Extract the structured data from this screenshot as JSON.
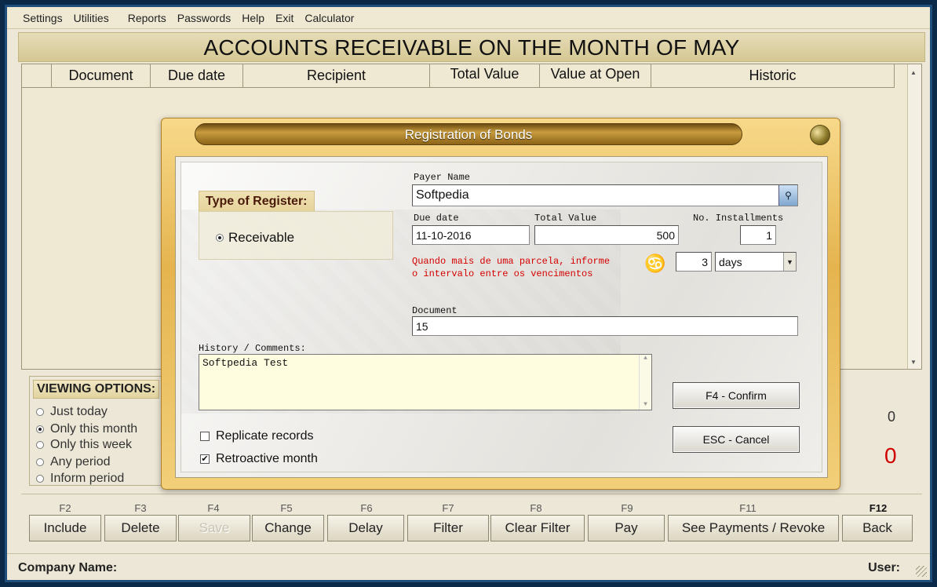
{
  "menu": [
    "Settings",
    "Utilities",
    "Reports",
    "Passwords",
    "Help",
    "Exit",
    "Calculator"
  ],
  "main_title": "ACCOUNTS RECEIVABLE ON THE MONTH OF MAY",
  "grid": {
    "columns": [
      "",
      "Document",
      "Due date",
      "Recipient",
      "Total Value",
      "Value at Open",
      "Historic"
    ]
  },
  "viewing_options": {
    "title": "VIEWING OPTIONS:",
    "options": [
      {
        "label": "Just today",
        "selected": false
      },
      {
        "label": "Only this month",
        "selected": true
      },
      {
        "label": "Only this week",
        "selected": false
      },
      {
        "label": "Any period",
        "selected": false
      },
      {
        "label": "Inform period",
        "selected": false
      }
    ]
  },
  "totals": {
    "count": "0",
    "value": "0",
    "value_color": "#d00000"
  },
  "function_bar": [
    {
      "key": "F2",
      "label": "Include",
      "enabled": true
    },
    {
      "key": "F3",
      "label": "Delete",
      "enabled": true
    },
    {
      "key": "F4",
      "label": "Save",
      "enabled": false
    },
    {
      "key": "F5",
      "label": "Change",
      "enabled": true
    },
    {
      "key": "F6",
      "label": "Delay",
      "enabled": true
    },
    {
      "key": "F7",
      "label": "Filter",
      "enabled": true
    },
    {
      "key": "F8",
      "label": "Clear Filter",
      "enabled": true
    },
    {
      "key": "F9",
      "label": "Pay",
      "enabled": true
    },
    {
      "key": "F11",
      "label": "See Payments / Revoke",
      "enabled": true
    },
    {
      "key": "F12",
      "label": "Back",
      "enabled": true
    }
  ],
  "status": {
    "company_label": "Company Name:",
    "user_label": "User:"
  },
  "dialog": {
    "title": "Registration of Bonds",
    "type_of_register": {
      "title": "Type of Register:",
      "option": "Receivable",
      "selected": true
    },
    "payer_name": {
      "label": "Payer Name",
      "value": "Softpedia"
    },
    "due_date": {
      "label": "Due date",
      "value": "11-10-2016"
    },
    "total_value": {
      "label": "Total Value",
      "value": "500"
    },
    "installments": {
      "label": "No. Installments",
      "value": "1"
    },
    "interval_note": [
      "Quando mais de uma parcela, informe",
      "o intervalo entre os vencimentos"
    ],
    "interval": {
      "value": "3",
      "unit": "days"
    },
    "document": {
      "label": "Document",
      "value": "15"
    },
    "history": {
      "label": "History / Comments:",
      "value": "Softpedia Test"
    },
    "replicate": {
      "label": "Replicate records",
      "checked": false
    },
    "retroactive": {
      "label": "Retroactive month",
      "checked": true
    },
    "confirm_label": "F4 - Confirm",
    "cancel_label": "ESC - Cancel"
  },
  "colors": {
    "accent_gold": "#e5b44f",
    "window_border": "#1f4f7a",
    "alert_red": "#d40000"
  }
}
